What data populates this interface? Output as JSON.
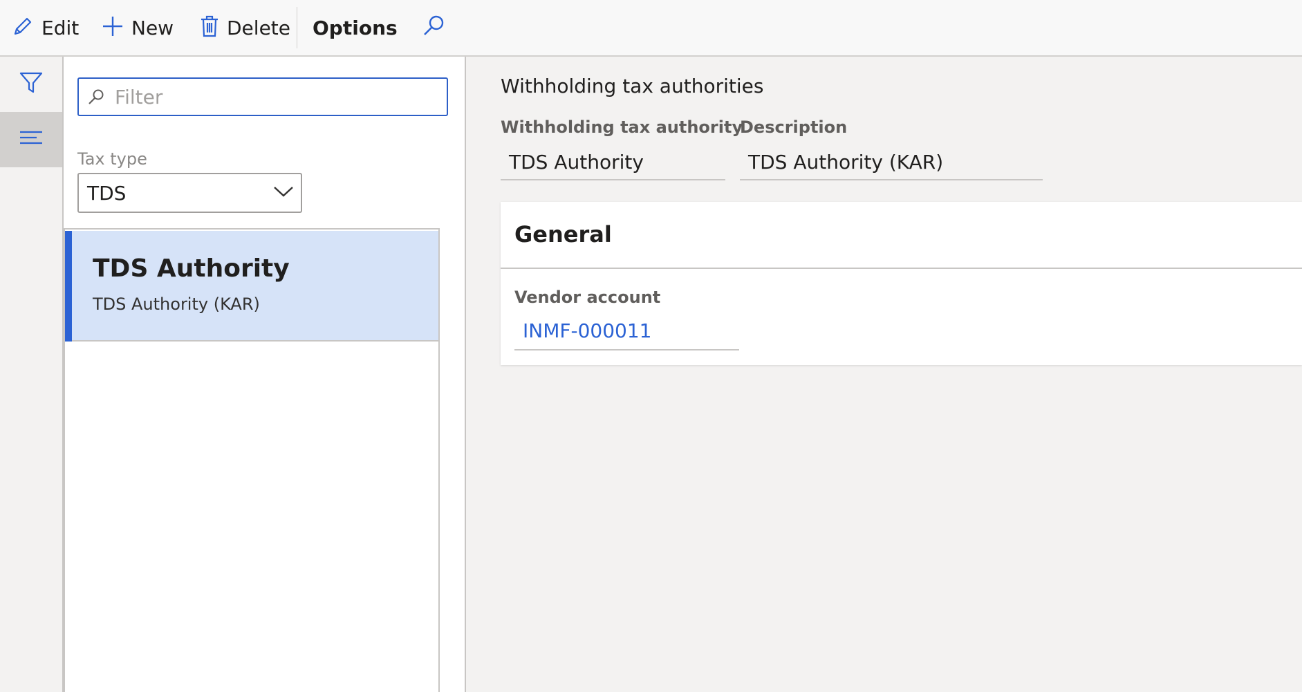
{
  "toolbar": {
    "edit_label": "Edit",
    "new_label": "New",
    "delete_label": "Delete",
    "options_label": "Options"
  },
  "list": {
    "filter_placeholder": "Filter",
    "tax_type_label": "Tax type",
    "tax_type_value": "TDS",
    "items": [
      {
        "title": "TDS Authority",
        "subtitle": "TDS Authority (KAR)"
      }
    ]
  },
  "details": {
    "header": "Withholding tax authorities",
    "authority_label": "Withholding tax authority",
    "authority_value": "TDS Authority",
    "description_label": "Description",
    "description_value": "TDS Authority (KAR)",
    "general": {
      "title": "General",
      "vendor_account_label": "Vendor account",
      "vendor_account_value": "INMF-000011"
    }
  },
  "colors": {
    "accent": "#2b62d4",
    "selected_bg": "#d6e3f8"
  },
  "icons": [
    "edit-icon",
    "plus-icon",
    "trash-icon",
    "search-icon",
    "filter-icon",
    "list-icon",
    "chevron-down-icon"
  ]
}
